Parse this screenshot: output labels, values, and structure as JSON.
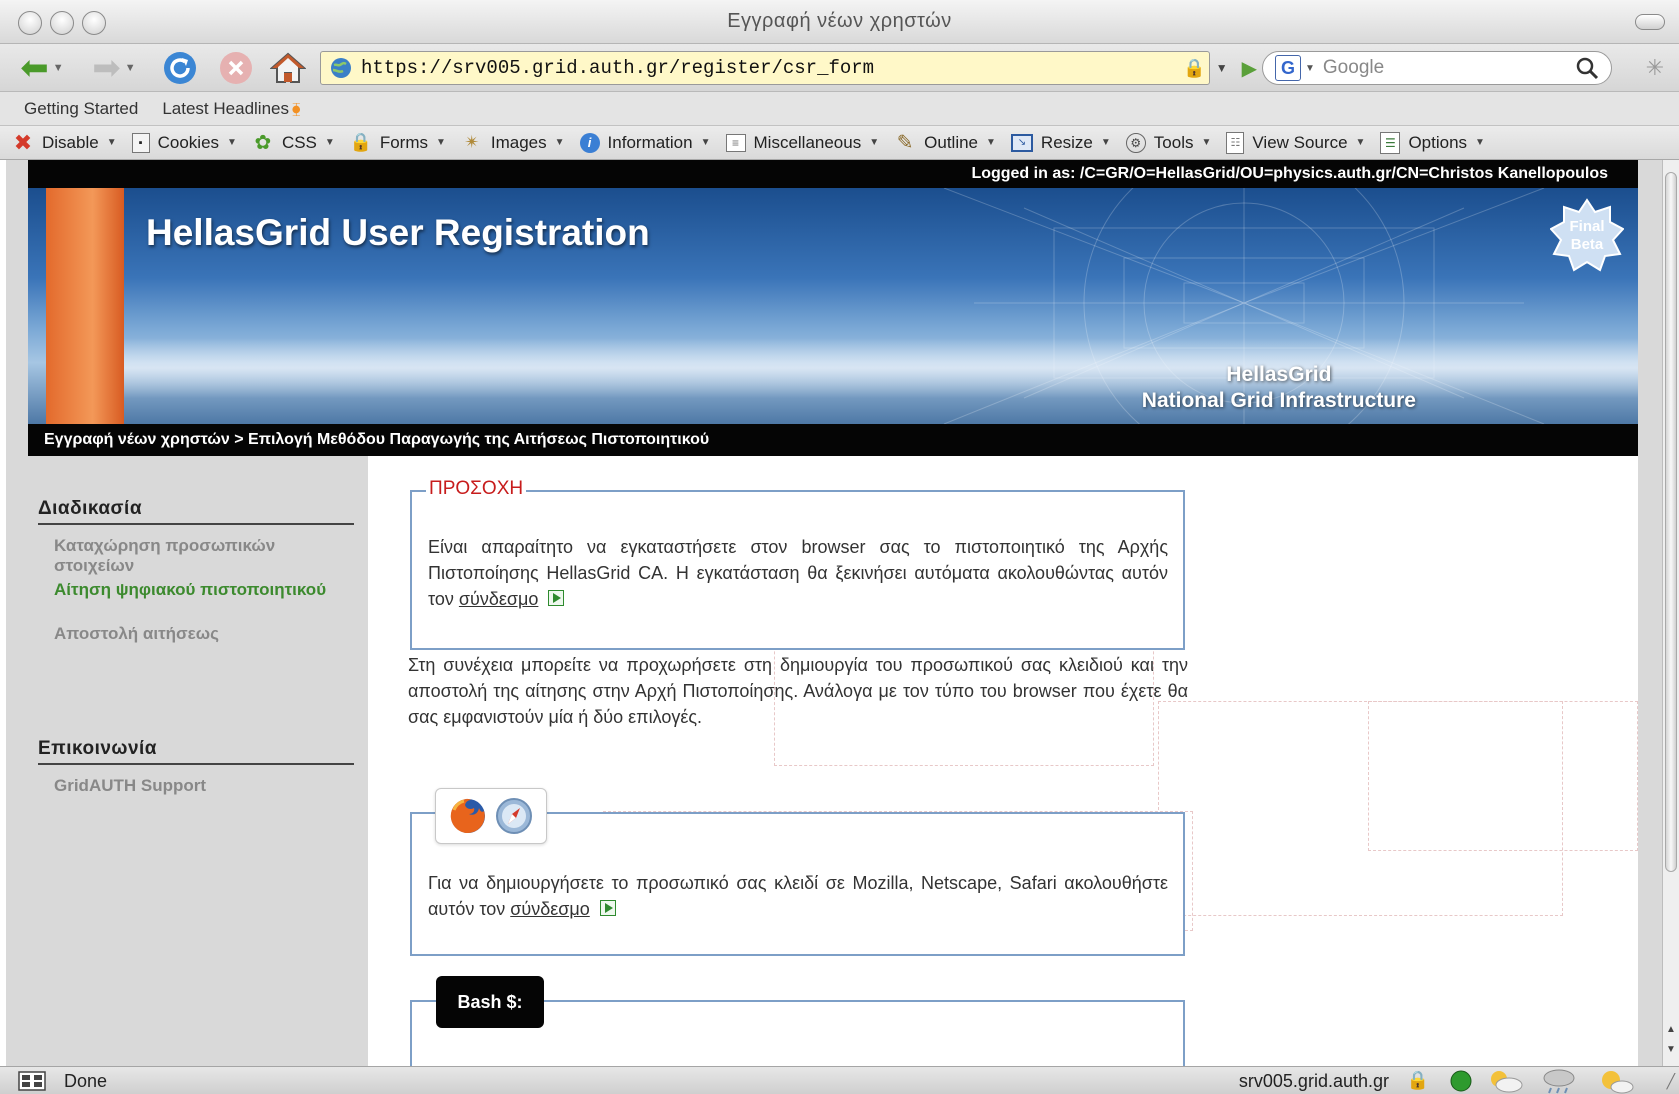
{
  "window": {
    "title": "Εγγραφή νέων χρηστών"
  },
  "navbar": {
    "url": "https://srv005.grid.auth.gr/register/csr_form",
    "search_placeholder": "Google"
  },
  "bookmarks": [
    {
      "label": "Getting Started"
    },
    {
      "label": "Latest Headlines"
    }
  ],
  "devbar": [
    {
      "label": "Disable",
      "icon": "disable-icon"
    },
    {
      "label": "Cookies",
      "icon": "cookies-icon"
    },
    {
      "label": "CSS",
      "icon": "css-icon"
    },
    {
      "label": "Forms",
      "icon": "forms-icon"
    },
    {
      "label": "Images",
      "icon": "images-icon"
    },
    {
      "label": "Information",
      "icon": "information-icon"
    },
    {
      "label": "Miscellaneous",
      "icon": "miscellaneous-icon"
    },
    {
      "label": "Outline",
      "icon": "outline-icon"
    },
    {
      "label": "Resize",
      "icon": "resize-icon"
    },
    {
      "label": "Tools",
      "icon": "tools-icon"
    },
    {
      "label": "View Source",
      "icon": "view-source-icon"
    },
    {
      "label": "Options",
      "icon": "options-icon"
    }
  ],
  "page": {
    "logged_in": "Logged in as: /C=GR/O=HellasGrid/OU=physics.auth.gr/CN=Christos Kanellopoulos",
    "banner_title": "HellasGrid User Registration",
    "banner_sub1": "HellasGrid",
    "banner_sub2": "National Grid Infrastructure",
    "badge_line1": "Final",
    "badge_line2": "Beta",
    "breadcrumb": "Εγγραφή νέων χρηστών > Επιλογή Μεθόδου Παραγωγής της Αιτήσεως Πιστοποιητικού"
  },
  "sidebar": {
    "process_heading": "Διαδικασία",
    "process_items": [
      {
        "label": "Καταχώρηση προσωπικών στοιχείων",
        "active": false
      },
      {
        "label": "Αίτηση ψηφιακού πιστοποιητικού",
        "active": true
      },
      {
        "label": "Αποστολή αιτήσεως",
        "active": false
      }
    ],
    "contact_heading": "Επικοινωνία",
    "contact_items": [
      {
        "label": "GridAUTH Support"
      }
    ]
  },
  "content": {
    "warning": {
      "legend": "ΠΡΟΣΟΧΗ",
      "text": "Είναι απαραίτητο να εγκαταστήσετε στον browser σας το πιστοποιητικό της Αρχής Πιστοποίησης HellasGrid CA. Η εγκατάσταση θα ξεκινήσει αυτόματα ακολουθώντας αυτόν τον",
      "link": "σύνδεσμο"
    },
    "intro": "Στη συνέχεια μπορείτε να προχωρήσετε στη δημιουργία του προσωπικού σας κλειδιού και την αποστολή της αίτησης στην Αρχή Πιστοποίησης. Ανάλογα με τον τύπο του browser που έχετε θα σας εμφανιστούν μία ή δύο επιλογές.",
    "mozilla": {
      "text": "Για να δημιουργήσετε το προσωπικό σας κλειδί σε Mozilla, Netscape, Safari ακολουθήστε αυτόν τον",
      "link": "σύνδεσμο"
    },
    "bash_label": "Bash $:"
  },
  "status": {
    "text": "Done",
    "host": "srv005.grid.auth.gr"
  }
}
